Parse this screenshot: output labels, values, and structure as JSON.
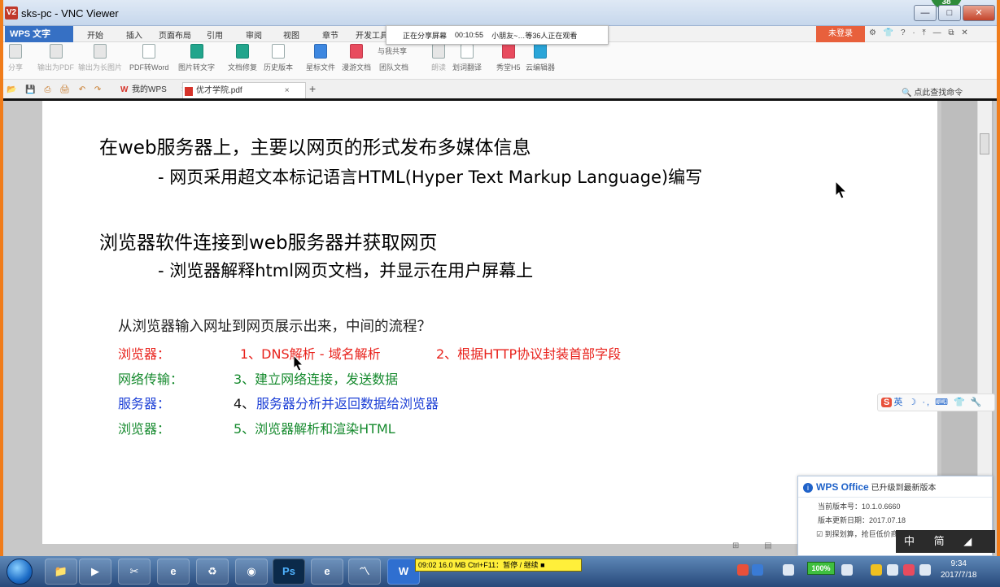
{
  "window": {
    "logo": "V2",
    "title": "sks-pc - VNC Viewer",
    "badge": "38",
    "minimize": "—",
    "restore": "□",
    "close": "✕"
  },
  "share_banner": {
    "status": "正在分享屏幕",
    "elapsed": "00:10:55",
    "viewers": "小朋友~…等36人正在观看"
  },
  "ribbon": {
    "brand": "WPS 文字",
    "tabs": [
      "开始",
      "插入",
      "页面布局",
      "引用",
      "审阅",
      "视图",
      "章节",
      "开发工具"
    ],
    "login": "未登录",
    "right_icons": "⚙ 👕 ? · ⤒ — ⧉ ✕"
  },
  "tools": [
    {
      "label": "分享",
      "dim": true
    },
    {
      "label": "输出为PDF",
      "dim": true
    },
    {
      "label": "输出为长图片",
      "dim": true
    },
    {
      "label": "PDF转Word",
      "dim": false
    },
    {
      "label": "图片转文字",
      "dim": false
    },
    {
      "label": "文档修复",
      "dim": false
    },
    {
      "label": "历史版本",
      "dim": false
    },
    {
      "label": "与我共享",
      "dim": false
    },
    {
      "label": "星标文件",
      "dim": false
    },
    {
      "label": "漫游文档",
      "dim": false
    },
    {
      "label": "团队文档",
      "dim": false
    },
    {
      "label": "朗读",
      "dim": true
    },
    {
      "label": "划词翻译",
      "dim": false
    },
    {
      "label": "秀堂H5",
      "dim": false
    },
    {
      "label": "云编辑器",
      "dim": false
    }
  ],
  "doc_tabs": {
    "quick_access": "📂 💾 ⎙ 🖨 ↶ ↷",
    "tab1": "我的WPS",
    "tab2": "优才学院.pdf",
    "close": "×",
    "plus": "+",
    "search": "🔍 点此查找命令"
  },
  "content": {
    "h1": "在web服务器上，主要以网页的形式发布多媒体信息",
    "h1_sub": "- 网页采用超文本标记语言HTML(Hyper Text Markup Language)编写",
    "h2": "浏览器软件连接到web服务器并获取网页",
    "h2_sub": "- 浏览器解释html网页文档，并显示在用户屏幕上",
    "question": "从浏览器输入网址到网页展示出来，中间的流程？",
    "rows": [
      {
        "label": "浏览器：",
        "step": "1、DNS解析 - 域名解析",
        "extra": "2、根据HTTP协议封装首部字段",
        "color": "#e8211b"
      },
      {
        "label": "网络传输：",
        "step": "3、建立网络连接，发送数据",
        "extra": "",
        "color": "#168a2e"
      },
      {
        "label": "服务器：",
        "step_prefix": "4、",
        "step": "服务器分析并返回数据给浏览器",
        "extra": "",
        "color": "#1c3fd6"
      },
      {
        "label": "浏览器：",
        "step": "5、浏览器解析和渲染HTML",
        "extra": "",
        "color": "#168a2e"
      }
    ]
  },
  "sogou": {
    "logo": "S",
    "text": "英 ☽ ·, ⌨ 👕 🔧"
  },
  "popup": {
    "brand": "WPS Office",
    "title": "已升级到最新版本",
    "version": "当前版本号：10.1.0.6660",
    "date": "版本更新日期：2017.07.18",
    "promo": "到探划算，抢巨低价商"
  },
  "ime": "中 简 ◢ °,",
  "statusbar_icons": "⊞ ▤ ▥",
  "taskbar": {
    "status_text": "09:02   16.0 MB    Ctrl+F11：暂停 / 继续   ■",
    "battery": "100%",
    "time": "9:34",
    "date": "2017/7/18",
    "apps": [
      "📁",
      "▶",
      "✂",
      "e",
      "♻",
      "◉",
      "Ps",
      "e",
      "〽",
      "W"
    ]
  }
}
